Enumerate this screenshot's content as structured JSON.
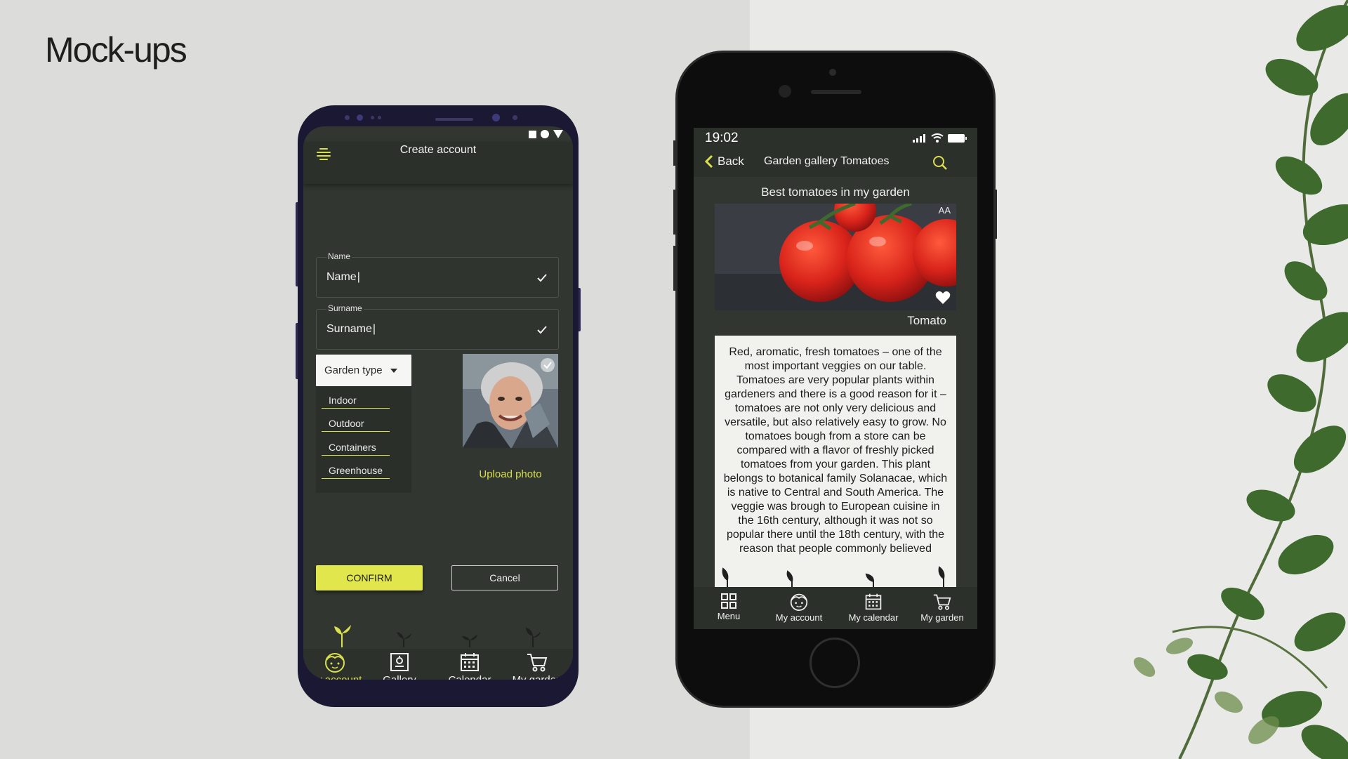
{
  "slide": {
    "title": "Mock-ups"
  },
  "android": {
    "header": {
      "title": "Create account"
    },
    "fields": [
      {
        "label": "Name",
        "value": "Name"
      },
      {
        "label": "Surname",
        "value": "Surname"
      }
    ],
    "dropdown": {
      "label": "Garden type",
      "options": [
        "Indoor",
        "Outdoor",
        "Containers",
        "Greenhouse"
      ]
    },
    "upload_label": "Upload photo",
    "buttons": {
      "confirm": "CONFIRM",
      "cancel": "Cancel"
    },
    "nav": [
      {
        "label": "My account",
        "icon": "account-icon",
        "active": true
      },
      {
        "label": "Gallery",
        "icon": "gallery-icon",
        "active": false
      },
      {
        "label": "Calendar",
        "icon": "calendar-icon",
        "active": false
      },
      {
        "label": "My garden",
        "icon": "cart-icon",
        "active": false
      }
    ],
    "accent_color": "#d9df4f"
  },
  "iphone": {
    "status": {
      "time": "19:02"
    },
    "header": {
      "back": "Back",
      "title": "Garden gallery Tomatoes"
    },
    "heading": "Best tomatoes in my garden",
    "photo": {
      "badge": "AA",
      "caption": "Tomato"
    },
    "description": "Red, aromatic, fresh tomatoes – one of the most important veggies on our table. Tomatoes are very popular plants within gardeners and there is a good reason for it – tomatoes are not only very delicious and versatile, but also relatively easy to grow. No tomatoes bough from a store can be compared with a flavor of freshly picked tomatoes from your garden. This plant belongs to botanical family Solanacae, which is native to Central and South America. The veggie was brough to European cuisine in the 16th century, although it was not so popular there until the 18th century, with the reason that people commonly believed",
    "nav": [
      {
        "label": "Menu",
        "icon": "grid-icon"
      },
      {
        "label": "My account",
        "icon": "account-icon"
      },
      {
        "label": "My calendar",
        "icon": "calendar-icon"
      },
      {
        "label": "My garden",
        "icon": "cart-icon"
      }
    ]
  }
}
